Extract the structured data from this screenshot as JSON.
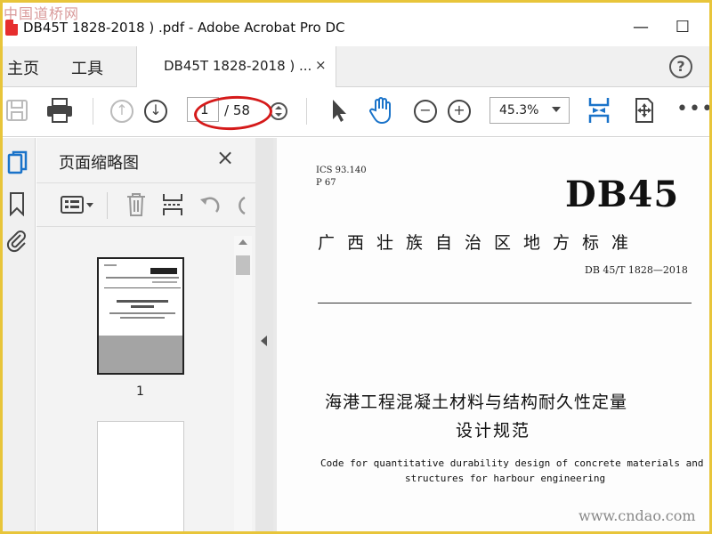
{
  "window": {
    "title": "DB45T 1828-2018 ) .pdf - Adobe Acrobat Pro DC",
    "minimize": "—",
    "maximize": "☐"
  },
  "watermarks": {
    "top": "中国道桥网",
    "bottom": "www.cndao.com"
  },
  "tabs": {
    "home": "主页",
    "tools": "工具",
    "document": "DB45T 1828-2018 ) ...",
    "close": "×",
    "help": "?"
  },
  "toolbar": {
    "current_page": "1",
    "page_total": "/ 58",
    "zoom": "45.3%"
  },
  "panel": {
    "title": "页面缩略图",
    "close": "×",
    "thumbnail_page_number": "1"
  },
  "document": {
    "ics": "ICS 93.140",
    "p_code": "P 67",
    "db_code": "DB45",
    "standard_name": "广西壮族自治区地方标准",
    "standard_number": "DB 45/T 1828—2018",
    "title_cn_line1": "海港工程混凝土材料与结构耐久性定量",
    "title_cn_line2": "设计规范",
    "title_en_line1": "Code for quantitative durability design of concrete materials and",
    "title_en_line2": "structures for harbour engineering"
  },
  "colors": {
    "accent_blue": "#1a73c9",
    "annotation_red": "#d51a1a",
    "frame_yellow": "#e8c53a"
  }
}
